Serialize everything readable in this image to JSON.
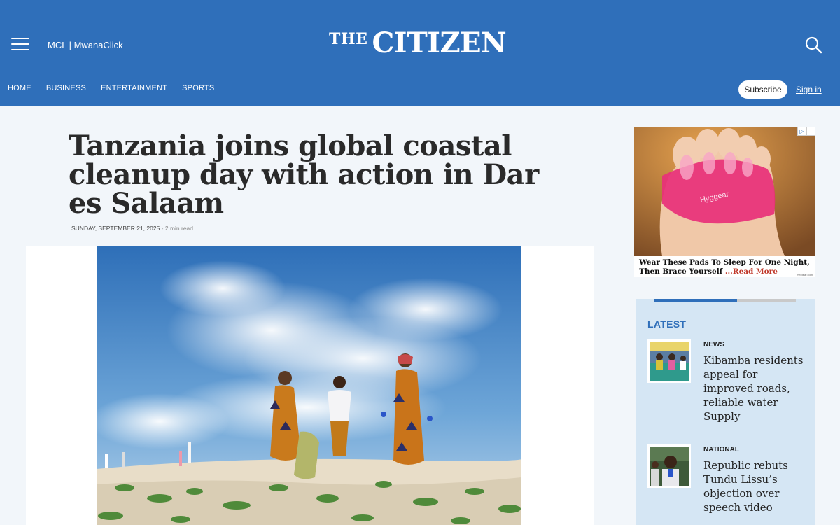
{
  "header": {
    "group_link": "MCL | MwanaClick",
    "logo_prefix": "THE",
    "logo_name": "CITIZEN",
    "nav": [
      "HOME",
      "BUSINESS",
      "ENTERTAINMENT",
      "SPORTS"
    ],
    "subscribe_label": "Subscribe",
    "signin_label": "Sign in"
  },
  "article": {
    "headline": "Tanzania joins global coastal cleanup day with action in Dar es Salaam",
    "date": "SUNDAY, SEPTEMBER 21, 2025",
    "read_time": " - 2 min read"
  },
  "ad": {
    "brand_on_image": "Hyggear",
    "text": "Wear These Pads To Sleep For One Night, Then Brace Yourself ",
    "read_more": "...Read More",
    "source": "hyggear.com"
  },
  "latest": {
    "title": "LATEST",
    "items": [
      {
        "category": "NEWS",
        "title": "Kibamba residents appeal for improved roads, reliable water Supply"
      },
      {
        "category": "NATIONAL",
        "title": "Republic rebuts Tundu Lissu’s objection over speech video"
      }
    ]
  },
  "colors": {
    "brand_blue": "#2f6fba",
    "page_bg": "#f2f6fa",
    "latest_bg": "#d5e6f4",
    "read_more": "#c0392b"
  }
}
